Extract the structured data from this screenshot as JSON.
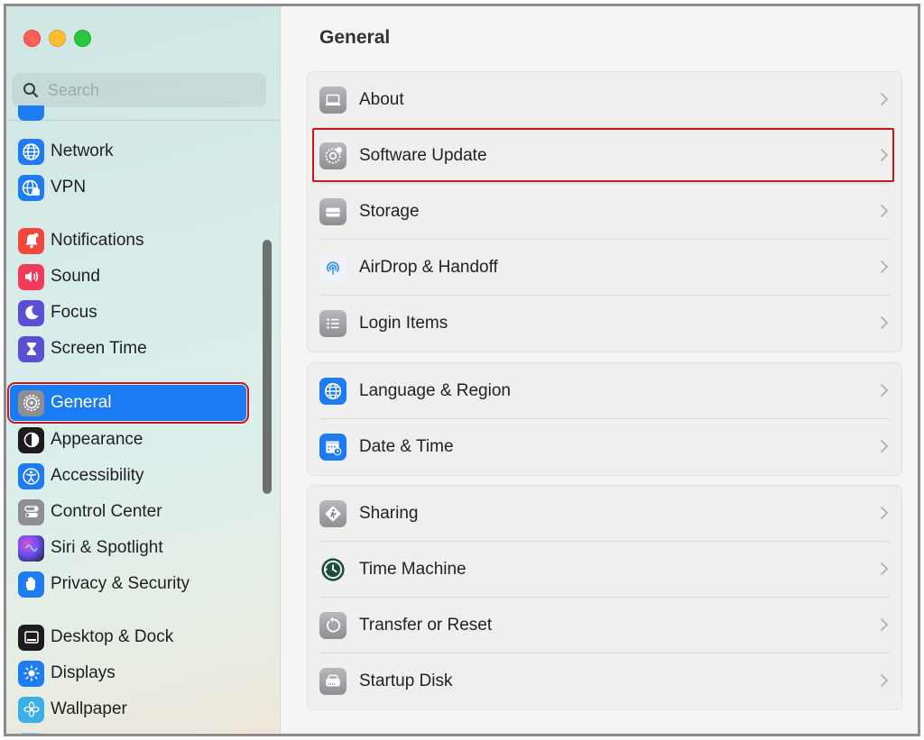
{
  "window": {
    "title": "General"
  },
  "sidebar": {
    "search_placeholder": "Search",
    "items": [
      {
        "label": "Network",
        "icon": "globe-icon",
        "color": "#1d7cf2"
      },
      {
        "label": "VPN",
        "icon": "globe-lock-icon",
        "color": "#1d7cf2"
      },
      {
        "label": "Notifications",
        "icon": "bell-icon",
        "color": "#f0463c"
      },
      {
        "label": "Sound",
        "icon": "speaker-icon",
        "color": "#f03c5a"
      },
      {
        "label": "Focus",
        "icon": "moon-icon",
        "color": "#5b4fd4"
      },
      {
        "label": "Screen Time",
        "icon": "hourglass-icon",
        "color": "#5b4fd4"
      },
      {
        "label": "General",
        "icon": "gear-icon",
        "color": "#8e8e93",
        "selected": true
      },
      {
        "label": "Appearance",
        "icon": "appearance-icon",
        "color": "#1c1c1e"
      },
      {
        "label": "Accessibility",
        "icon": "accessibility-icon",
        "color": "#1d7cf2"
      },
      {
        "label": "Control Center",
        "icon": "toggles-icon",
        "color": "#8e8e93"
      },
      {
        "label": "Siri & Spotlight",
        "icon": "siri-icon",
        "color": "#2b2b6e"
      },
      {
        "label": "Privacy & Security",
        "icon": "hand-icon",
        "color": "#1d7cf2"
      },
      {
        "label": "Desktop & Dock",
        "icon": "dock-icon",
        "color": "#1c1c1e"
      },
      {
        "label": "Displays",
        "icon": "sun-icon",
        "color": "#1d7cf2"
      },
      {
        "label": "Wallpaper",
        "icon": "flower-icon",
        "color": "#3ab0e8"
      }
    ]
  },
  "main": {
    "title": "General",
    "groups": [
      [
        {
          "label": "About",
          "icon": "laptop-icon"
        },
        {
          "label": "Software Update",
          "icon": "gear-badge-icon"
        },
        {
          "label": "Storage",
          "icon": "drive-icon"
        },
        {
          "label": "AirDrop & Handoff",
          "icon": "airdrop-icon"
        },
        {
          "label": "Login Items",
          "icon": "list-icon"
        }
      ],
      [
        {
          "label": "Language & Region",
          "icon": "globe-icon"
        },
        {
          "label": "Date & Time",
          "icon": "calendar-clock-icon"
        }
      ],
      [
        {
          "label": "Sharing",
          "icon": "sharing-icon"
        },
        {
          "label": "Time Machine",
          "icon": "time-machine-icon"
        },
        {
          "label": "Transfer or Reset",
          "icon": "reset-icon"
        },
        {
          "label": "Startup Disk",
          "icon": "disk-icon"
        }
      ]
    ]
  },
  "colors": {
    "accent": "#1a7cf2",
    "highlight": "#c8161d"
  }
}
